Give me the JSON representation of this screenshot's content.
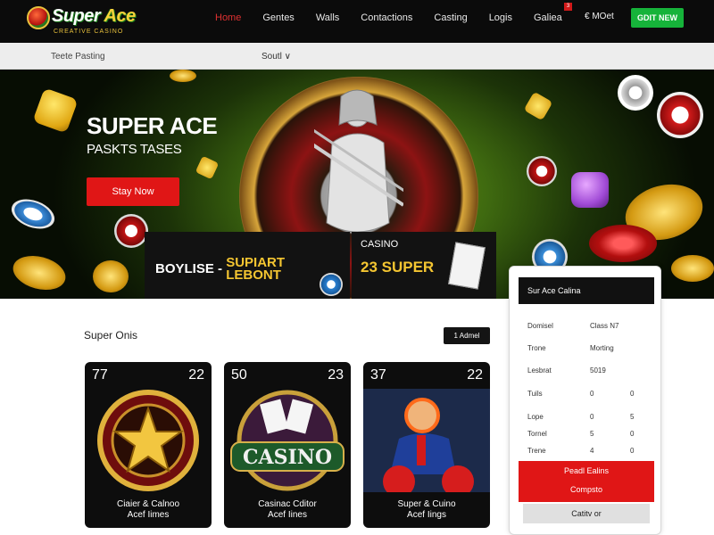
{
  "brand": {
    "name_part1": "Super",
    "name_part2": "Ace",
    "tagline": "CREATIVE CASINO"
  },
  "nav": {
    "items": [
      {
        "label": "Home",
        "active": true
      },
      {
        "label": "Gentes",
        "active": false
      },
      {
        "label": "Walls",
        "active": false
      },
      {
        "label": "Contactions",
        "active": false
      },
      {
        "label": "Casting",
        "active": false
      },
      {
        "label": "Logis",
        "active": false
      },
      {
        "label": "Galiea",
        "active": false,
        "badge": "3"
      }
    ],
    "mid_label": "€ MOet",
    "cta_label": "GDIT NEW"
  },
  "subbar": {
    "left_label": "Teete Pasting",
    "sort_label": "Soutl ∨"
  },
  "hero": {
    "title": "SUPER ACE",
    "subtitle": "PASKTS TASES",
    "button_label": "Stay Now",
    "promo_left_main": "BOYLISE -",
    "promo_left_accent1": "SUPIART",
    "promo_left_accent2": "LEBONT",
    "promo_right_top": "CASINO",
    "promo_right_main": "23 SUPER"
  },
  "games": {
    "section_title": "Super Onis",
    "section_button": "1 Admel",
    "cards": [
      {
        "num_left": "77",
        "num_right": "22",
        "label_line1": "Ciaier & Calnoo",
        "label_line2": "Acef Iimes"
      },
      {
        "num_left": "50",
        "num_right": "23",
        "label_line1": "Casinac Cditor",
        "label_line2": "Acef Iines",
        "art_text": "CASINO"
      },
      {
        "num_left": "37",
        "num_right": "22",
        "label_line1": "Super & Cuino",
        "label_line2": "Acef Iings"
      }
    ]
  },
  "panel": {
    "title": "Sur Ace Calina",
    "rows": [
      {
        "c1": "Domisel",
        "c2": "Class N7",
        "c3": ""
      },
      {
        "c1": "Trone",
        "c2": "Morting",
        "c3": ""
      },
      {
        "c1": "Lesbrat",
        "c2": "5019",
        "c3": ""
      },
      {
        "c1": "Tuils",
        "c2": "0",
        "c3": "0"
      },
      {
        "c1": "Lope",
        "c2": "0",
        "c3": "5"
      },
      {
        "c1": "Tornel",
        "c2": "5",
        "c3": "0"
      },
      {
        "c1": "Trene",
        "c2": "4",
        "c3": "0"
      }
    ],
    "red_line1": "Peadl Ealins",
    "red_line2": "Compsto",
    "gray_button": "Catitv or"
  }
}
